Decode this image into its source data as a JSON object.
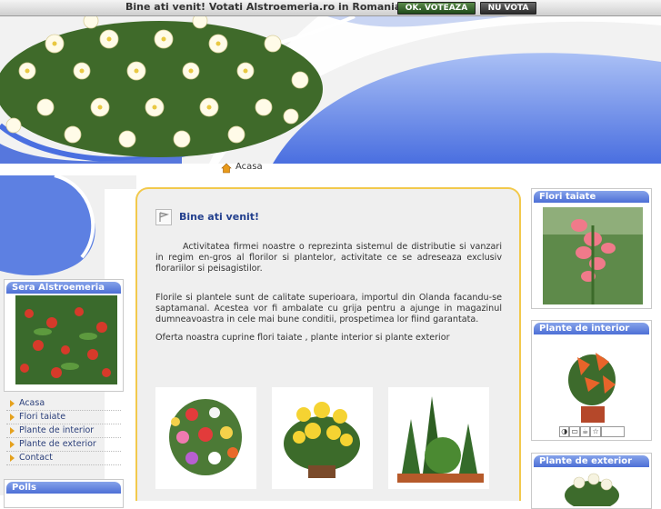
{
  "topbar": {
    "text": "Bine ati venit! Votati Alstroemeria.ro in Romanian Top 66",
    "vote_ok": "OK. VOTEAZA",
    "vote_no": "NU VOTA"
  },
  "breadcrumb": {
    "home": "Acasa"
  },
  "left": {
    "sera_title": "Sera Alstroemeria",
    "nav": [
      "Acasa",
      "Flori taiate",
      "Plante de interior",
      "Plante de exterior",
      "Contact"
    ],
    "polls_title": "Polls"
  },
  "main": {
    "title": "Bine ati venit!",
    "p1": "Activitatea firmei noastre o reprezinta sistemul de distributie si vanzari in regim en-gros al florilor si plantelor, activitate ce se adreseaza exclusiv florariilor si peisagistilor.",
    "p2": "Florile si plantele sunt de calitate superioara, importul din Olanda facandu-se saptamanal. Acestea vor fi ambalate cu grija pentru a ajunge in magazinul dumneavoastra in cele mai bune conditii, prospetimea lor fiind garantata.",
    "p3": "Oferta noastra cuprine flori taiate , plante interior si plante exterior"
  },
  "right": {
    "box1_title": "Flori taiate",
    "box2_title": "Plante de interior",
    "box3_title": "Plante de exterior",
    "tools": [
      "◑",
      "▭",
      "☕",
      "☆",
      ""
    ]
  },
  "colors": {
    "accent_blue": "#4d6fd6",
    "border_gold": "#f2c94c",
    "nav_text": "#2b3f7a"
  }
}
